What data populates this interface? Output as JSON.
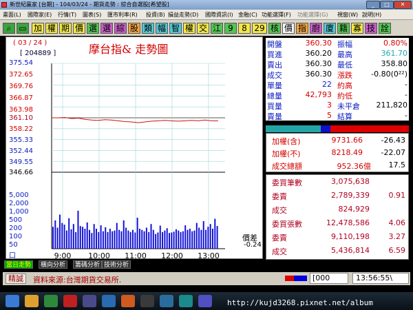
{
  "window": {
    "title": "新世紀贏家 [台期] - 104/03/24 - 期貨走勢 : 綜合自選股[希望股]",
    "min": "_",
    "max": "□",
    "close": "✕"
  },
  "menu": [
    "畫面(L)",
    "國際家(E)",
    "行情(T)",
    "圖表(S)",
    "匯市利率(R)",
    "投資(B)",
    "損益走勢(D)",
    "國際資訊(I)",
    "金融(C)",
    "功能選擇(F)",
    "功能選擇(G)",
    "視窗(W)",
    "說明(H)"
  ],
  "toolbar": {
    "icons": [
      "search-icon",
      "window-icon"
    ],
    "buttons": [
      "加",
      "權",
      "期",
      "價",
      "選",
      "選",
      "綜",
      "股",
      "類",
      "幅",
      "智",
      "權",
      "交",
      "江",
      "9",
      "8",
      "29",
      "核",
      "價",
      "指",
      "廚",
      "廈",
      "籍",
      "寡",
      "技",
      "詮"
    ]
  },
  "chart": {
    "date": "( 03 / 24 )",
    "count": "[ 204889 ]",
    "title": "摩台指&  走勢圖",
    "price_diff_label": "價差",
    "price_diff_value": "-0.24",
    "bottom_marker": "口",
    "price_ticks": [
      "375.54",
      "372.65",
      "369.76",
      "366.87",
      "363.98",
      "361.10",
      "358.22",
      "355.33",
      "352.44",
      "349.55",
      "346.66"
    ],
    "volume_ticks": [
      "5,000",
      "2,000",
      "1,000",
      "500",
      "200",
      "100",
      "50"
    ]
  },
  "chart_data": {
    "type": "line",
    "x_ticks": [
      "9:00",
      "10:00",
      "11:00",
      "12:00",
      "13:00"
    ],
    "ylim": [
      346.66,
      375.54
    ],
    "reference_price": 361.1,
    "series": [
      {
        "values": [
          361.1,
          361.1,
          361.2,
          360.9,
          361.0,
          360.7,
          360.5,
          360.4,
          360.6,
          360.5,
          360.3,
          360.1,
          360.0,
          359.8,
          360.0,
          360.2,
          360.3,
          360.4,
          360.3,
          360.2,
          360.3,
          360.4,
          360.3,
          360.5,
          360.3,
          360.3
        ]
      }
    ],
    "volume": [
      180,
      420,
      160,
      900,
      300,
      240,
      110,
      560,
      130,
      260,
      90,
      1500,
      200,
      180,
      140,
      320,
      120,
      80,
      260,
      140,
      90,
      220,
      100,
      170,
      90,
      140,
      100,
      110,
      300,
      120,
      100,
      420,
      160,
      110,
      90,
      120,
      85,
      600,
      140,
      120,
      100,
      160,
      90,
      260,
      120,
      70,
      85,
      210,
      90,
      110,
      150,
      80,
      85,
      95,
      130,
      110,
      90,
      100,
      220,
      120,
      140,
      100,
      110,
      300,
      160,
      120,
      380,
      120,
      180,
      260,
      140,
      520,
      200
    ]
  },
  "quote": {
    "rows": [
      {
        "l1": "開盤",
        "v1": "360.30",
        "l2": "振幅",
        "v2": "0.80%"
      },
      {
        "l1": "買進",
        "v1": "360.20",
        "l2": "最高",
        "v2": "361.70"
      },
      {
        "l1": "賣出",
        "v1": "360.30",
        "l2": "最低",
        "v2": "358.80"
      },
      {
        "l1": "成交",
        "v1": "360.30",
        "l2": "漲跌",
        "v2": "-0.80(0²²)"
      },
      {
        "l1": "單量",
        "v1": "22",
        "l2": "約高",
        "v2": "-"
      },
      {
        "l1": "總量",
        "v1": "42,793",
        "l2": "約低",
        "v2": "-"
      },
      {
        "l1": "買量",
        "v1": "3",
        "l2": "未平倉",
        "v2": "211,820"
      },
      {
        "l1": "賣量",
        "v1": "5",
        "l2": "結算",
        "v2": "-"
      }
    ],
    "bar_color_buy": "#23a5a8",
    "bar_color_sell": "#1010c8"
  },
  "index": {
    "rows": [
      {
        "label": "加權(含)",
        "value": "9731.66",
        "change": "-26.43"
      },
      {
        "label": "加權(不)",
        "value": "8218.49",
        "change": "-22.07"
      },
      {
        "label": "成交總額",
        "value": "952.36億",
        "change": "17.5"
      }
    ]
  },
  "orders": {
    "rows": [
      {
        "label": "委買筆數",
        "value": "3,075,638",
        "ratio": ""
      },
      {
        "label": "委賣",
        "value": "2,789,339",
        "ratio": "0.91"
      },
      {
        "label": "成交",
        "value": "824,929",
        "ratio": ""
      },
      {
        "label": "委買張數",
        "value": "12,478,586",
        "ratio": "4.06"
      },
      {
        "label": "委賣",
        "value": "9,110,198",
        "ratio": "3.27"
      },
      {
        "label": "成交",
        "value": "5,436,814",
        "ratio": "6.59"
      }
    ]
  },
  "tabs": [
    "當日走勢",
    "橫向分析",
    "籌碼分析",
    "技術分析"
  ],
  "status": {
    "button": "精誠",
    "message": "資料來源:台灣期貨交易所.",
    "code": "[000",
    "time": "13:56:55\\"
  },
  "watermark": "http://kujd3268.pixnet.net/album"
}
